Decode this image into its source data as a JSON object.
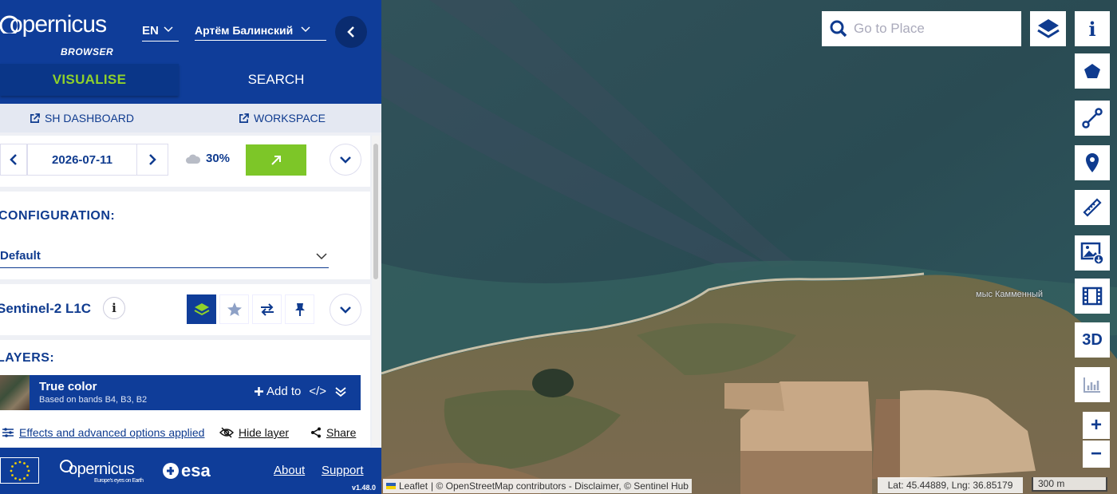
{
  "header": {
    "logo_text": "opernicus",
    "logo_sub": "BROWSER",
    "language": "EN",
    "user_name": "Артём Балинский",
    "tabs": [
      {
        "label": "VISUALISE",
        "active": true
      },
      {
        "label": "SEARCH",
        "active": false
      }
    ]
  },
  "links": {
    "dashboard": "SH DASHBOARD",
    "workspace": "WORKSPACE"
  },
  "date_panel": {
    "date": "2026-07-11",
    "cloud_coverage": "30%"
  },
  "configuration": {
    "title": "CONFIGURATION:",
    "selected": "Default"
  },
  "dataset": {
    "name": "Sentinel-2 L1C",
    "info": "i"
  },
  "layers": {
    "title": "LAYERS:",
    "items": [
      {
        "name": "True color",
        "description": "Based on bands B4, B3, B2",
        "add_label": "Add to",
        "code_label": "</>"
      }
    ]
  },
  "options": {
    "effects_label": "Effects and advanced options applied",
    "hide_label": "Hide layer",
    "share_label": "Share"
  },
  "footer": {
    "logo_text": "opernicus",
    "logo_tag": "Europe's eyes on Earth",
    "esa_label": "esa",
    "about": "About",
    "support": "Support",
    "version": "v1.48.0"
  },
  "map": {
    "search_placeholder": "Go to Place",
    "tools": [
      {
        "id": "info",
        "label": "i"
      },
      {
        "id": "polygon",
        "label": ""
      },
      {
        "id": "line",
        "label": ""
      },
      {
        "id": "poi",
        "label": ""
      },
      {
        "id": "measure",
        "label": ""
      },
      {
        "id": "image-download",
        "label": ""
      },
      {
        "id": "timelapse",
        "label": ""
      },
      {
        "id": "3d",
        "label": "3D"
      },
      {
        "id": "histogram",
        "label": ""
      }
    ],
    "zoom_in": "+",
    "zoom_out": "−",
    "place_label": "мыс Камменный",
    "attribution_leaflet": "Leaflet",
    "attribution_rest": "| © OpenStreetMap contributors - Disclaimer, © Sentinel Hub",
    "latlng": "Lat: 45.44889, Lng: 36.85179",
    "scale": "300 m"
  },
  "colors": {
    "brand_blue": "#0f3d99",
    "accent_green": "#7dc628",
    "tab_active_text": "#8fd12b"
  }
}
